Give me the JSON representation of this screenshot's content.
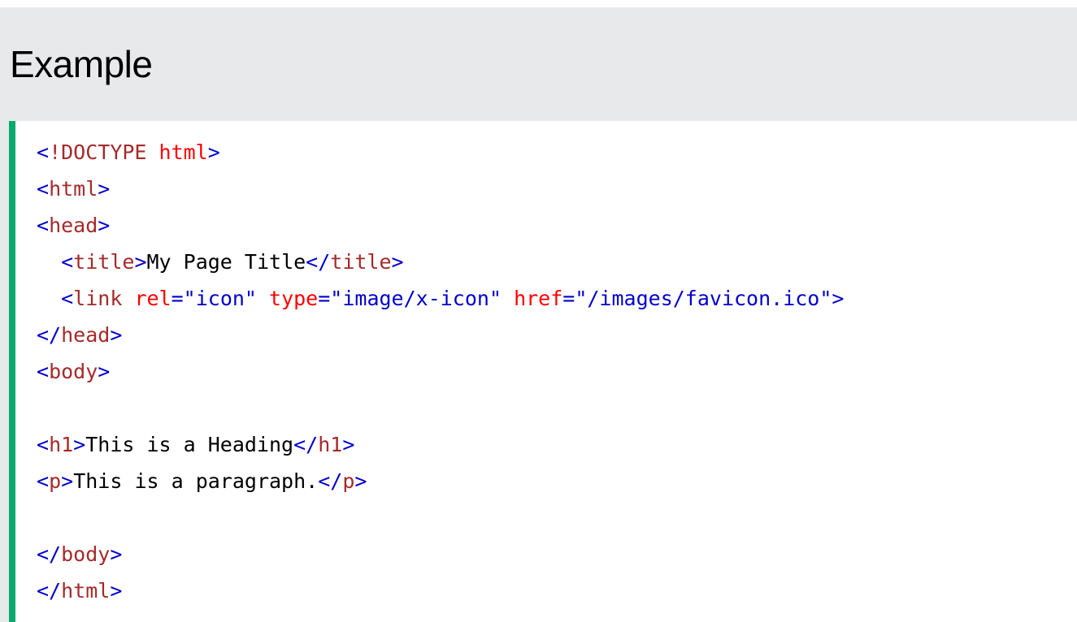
{
  "example": {
    "heading": "Example"
  },
  "code": {
    "colors": {
      "bracket": "#0000cd",
      "tag": "#a52a2a",
      "attribute": "#ff0000",
      "attribute_value": "#0000cd",
      "text": "#000000",
      "accent_border": "#04aa6d",
      "panel_background": "#e7e9eb"
    },
    "lines": [
      {
        "indent": "",
        "tokens": [
          {
            "t": "bracket",
            "v": "<"
          },
          {
            "t": "tag",
            "v": "!DOCTYPE "
          },
          {
            "t": "attr",
            "v": "html"
          },
          {
            "t": "bracket",
            "v": ">"
          }
        ]
      },
      {
        "indent": "",
        "tokens": [
          {
            "t": "bracket",
            "v": "<"
          },
          {
            "t": "tag",
            "v": "html"
          },
          {
            "t": "bracket",
            "v": ">"
          }
        ]
      },
      {
        "indent": "",
        "tokens": [
          {
            "t": "bracket",
            "v": "<"
          },
          {
            "t": "tag",
            "v": "head"
          },
          {
            "t": "bracket",
            "v": ">"
          }
        ]
      },
      {
        "indent": "  ",
        "tokens": [
          {
            "t": "bracket",
            "v": "<"
          },
          {
            "t": "tag",
            "v": "title"
          },
          {
            "t": "bracket",
            "v": ">"
          },
          {
            "t": "txt",
            "v": "My Page Title"
          },
          {
            "t": "bracket",
            "v": "</"
          },
          {
            "t": "tag",
            "v": "title"
          },
          {
            "t": "bracket",
            "v": ">"
          }
        ]
      },
      {
        "indent": "  ",
        "tokens": [
          {
            "t": "bracket",
            "v": "<"
          },
          {
            "t": "tag",
            "v": "link"
          },
          {
            "t": "attr",
            "v": " rel"
          },
          {
            "t": "val",
            "v": "=\"icon\""
          },
          {
            "t": "attr",
            "v": " type"
          },
          {
            "t": "val",
            "v": "=\"image/x-icon\""
          },
          {
            "t": "attr",
            "v": " href"
          },
          {
            "t": "val",
            "v": "=\"/images/favicon.ico\""
          },
          {
            "t": "bracket",
            "v": ">"
          }
        ]
      },
      {
        "indent": "",
        "tokens": [
          {
            "t": "bracket",
            "v": "</"
          },
          {
            "t": "tag",
            "v": "head"
          },
          {
            "t": "bracket",
            "v": ">"
          }
        ]
      },
      {
        "indent": "",
        "tokens": [
          {
            "t": "bracket",
            "v": "<"
          },
          {
            "t": "tag",
            "v": "body"
          },
          {
            "t": "bracket",
            "v": ">"
          }
        ]
      },
      {
        "indent": "",
        "tokens": []
      },
      {
        "indent": "",
        "tokens": [
          {
            "t": "bracket",
            "v": "<"
          },
          {
            "t": "tag",
            "v": "h1"
          },
          {
            "t": "bracket",
            "v": ">"
          },
          {
            "t": "txt",
            "v": "This is a Heading"
          },
          {
            "t": "bracket",
            "v": "</"
          },
          {
            "t": "tag",
            "v": "h1"
          },
          {
            "t": "bracket",
            "v": ">"
          }
        ]
      },
      {
        "indent": "",
        "tokens": [
          {
            "t": "bracket",
            "v": "<"
          },
          {
            "t": "tag",
            "v": "p"
          },
          {
            "t": "bracket",
            "v": ">"
          },
          {
            "t": "txt",
            "v": "This is a paragraph."
          },
          {
            "t": "bracket",
            "v": "</"
          },
          {
            "t": "tag",
            "v": "p"
          },
          {
            "t": "bracket",
            "v": ">"
          }
        ]
      },
      {
        "indent": "",
        "tokens": []
      },
      {
        "indent": "",
        "tokens": [
          {
            "t": "bracket",
            "v": "</"
          },
          {
            "t": "tag",
            "v": "body"
          },
          {
            "t": "bracket",
            "v": ">"
          }
        ]
      },
      {
        "indent": "",
        "tokens": [
          {
            "t": "bracket",
            "v": "</"
          },
          {
            "t": "tag",
            "v": "html"
          },
          {
            "t": "bracket",
            "v": ">"
          }
        ]
      }
    ]
  }
}
